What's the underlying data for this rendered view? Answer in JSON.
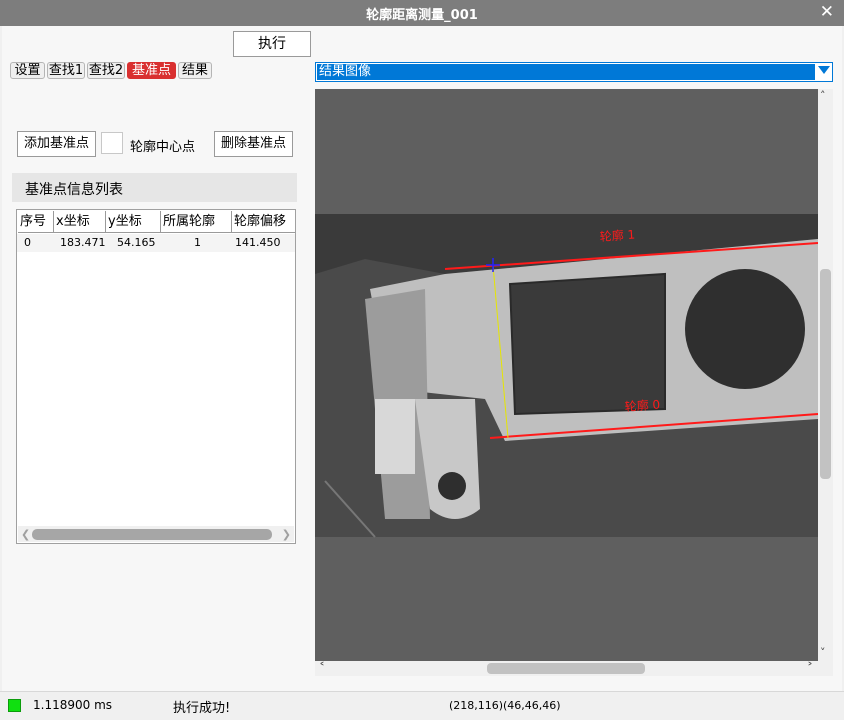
{
  "window": {
    "title": "轮廓距离测量_001",
    "close_label": "✕"
  },
  "toolbar": {
    "exec_label": "执行"
  },
  "tabs": [
    {
      "label": "设置"
    },
    {
      "label": "查找1"
    },
    {
      "label": "查找2"
    },
    {
      "label": "基准点",
      "active": true
    },
    {
      "label": "结果"
    }
  ],
  "image_select": {
    "value": "结果图像"
  },
  "actions": {
    "add_label": "添加基准点",
    "center_label": "轮廓中心点",
    "delete_label": "删除基准点"
  },
  "panel": {
    "title": "基准点信息列表"
  },
  "table": {
    "columns": [
      "序号",
      "x坐标",
      "y坐标",
      "所属轮廓",
      "轮廓偏移"
    ],
    "rows": [
      [
        "0",
        "183.471",
        "54.165",
        "1",
        "141.450"
      ]
    ]
  },
  "image": {
    "contour_labels": [
      "轮廓 1",
      "轮廓 0"
    ]
  },
  "status": {
    "time": "1.118900 ms",
    "message": "执行成功!",
    "coords": "(218,116)",
    "rgb": "(46,46,46)"
  },
  "colors": {
    "accent": "#0078d7",
    "active_tab": "#d93030",
    "contour_line": "#ff1a1a",
    "status_ok": "#10e010"
  }
}
